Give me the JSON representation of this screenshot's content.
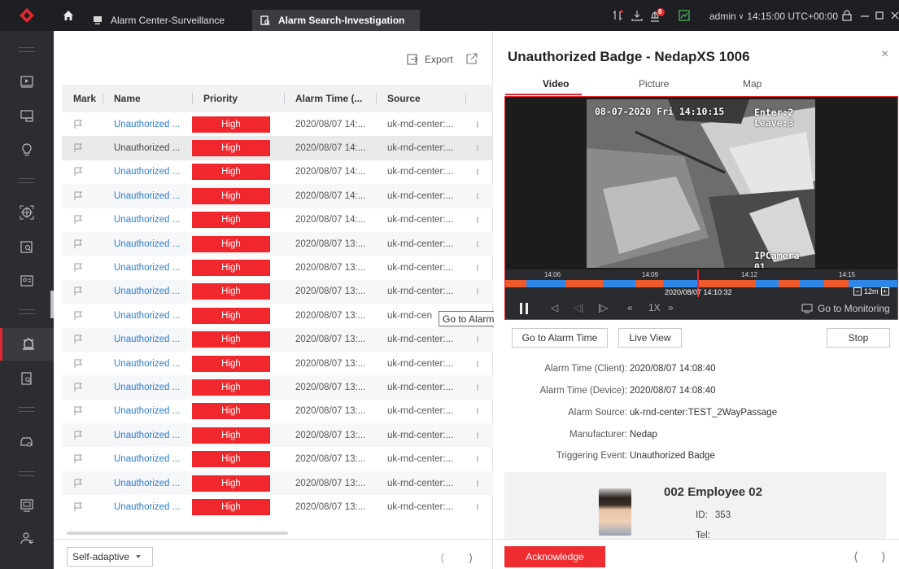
{
  "colors": {
    "accent": "#e1292f",
    "link": "#2a7cd6",
    "priority_high": "#f0282d",
    "topbar": "#1e1f22",
    "sidebar": "#2c2d30"
  },
  "topbar": {
    "tabs": [
      {
        "label": "Alarm Center-Surveillance",
        "icon": "monitor-icon"
      },
      {
        "label": "Alarm Search-Investigation",
        "icon": "search-doc-icon"
      }
    ],
    "notification_count": "8",
    "user": "admin",
    "time": "14:15:00 UTC+00:00"
  },
  "sidebar": {
    "items": [
      "play-screen-icon",
      "camera-screen-icon",
      "bulb-icon",
      "target-icon",
      "calendar-search-icon",
      "id-card-icon",
      "alarm-bell-icon",
      "document-search-icon",
      "vehicle-search-icon",
      "screen-icon",
      "person-icon"
    ],
    "active": "alarm-bell-icon"
  },
  "toolbar": {
    "export_label": "Export"
  },
  "table": {
    "columns": [
      "Mark",
      "Name",
      "Priority",
      "Alarm Time (...",
      "Source"
    ],
    "rows": [
      {
        "name": "Unauthorized ...",
        "priority": "High",
        "time": "2020/08/07 14:...",
        "source": "uk-rnd-center:..."
      },
      {
        "name": "Unauthorized ...",
        "priority": "High",
        "time": "2020/08/07 14:...",
        "source": "uk-rnd-center:..."
      },
      {
        "name": "Unauthorized ...",
        "priority": "High",
        "time": "2020/08/07 14:...",
        "source": "uk-rnd-center:..."
      },
      {
        "name": "Unauthorized ...",
        "priority": "High",
        "time": "2020/08/07 14:...",
        "source": "uk-rnd-center:..."
      },
      {
        "name": "Unauthorized ...",
        "priority": "High",
        "time": "2020/08/07 14:...",
        "source": "uk-rnd-center:..."
      },
      {
        "name": "Unauthorized ...",
        "priority": "High",
        "time": "2020/08/07 13:...",
        "source": "uk-rnd-center:..."
      },
      {
        "name": "Unauthorized ...",
        "priority": "High",
        "time": "2020/08/07 13:...",
        "source": "uk-rnd-center:..."
      },
      {
        "name": "Unauthorized ...",
        "priority": "High",
        "time": "2020/08/07 13:...",
        "source": "uk-rnd-center:..."
      },
      {
        "name": "Unauthorized ...",
        "priority": "High",
        "time": "2020/08/07 13:...",
        "source": "uk-rnd-cen"
      },
      {
        "name": "Unauthorized ...",
        "priority": "High",
        "time": "2020/08/07 13:...",
        "source": "uk-rnd-center:..."
      },
      {
        "name": "Unauthorized ...",
        "priority": "High",
        "time": "2020/08/07 13:...",
        "source": "uk-rnd-center:..."
      },
      {
        "name": "Unauthorized ...",
        "priority": "High",
        "time": "2020/08/07 13:...",
        "source": "uk-rnd-center:..."
      },
      {
        "name": "Unauthorized ...",
        "priority": "High",
        "time": "2020/08/07 13:...",
        "source": "uk-rnd-center:..."
      },
      {
        "name": "Unauthorized ...",
        "priority": "High",
        "time": "2020/08/07 13:...",
        "source": "uk-rnd-center:..."
      },
      {
        "name": "Unauthorized ...",
        "priority": "High",
        "time": "2020/08/07 13:...",
        "source": "uk-rnd-center:..."
      },
      {
        "name": "Unauthorized ...",
        "priority": "High",
        "time": "2020/08/07 13:...",
        "source": "uk-rnd-center:..."
      },
      {
        "name": "Unauthorized ...",
        "priority": "High",
        "time": "2020/08/07 13:...",
        "source": "uk-rnd-center:..."
      }
    ],
    "selected_row": 1
  },
  "footer": {
    "display_mode": "Self-adaptive"
  },
  "tooltip": "Go to Alarm Time",
  "detail": {
    "title": "Unauthorized Badge - NedapXS 1006",
    "tabs": [
      "Video",
      "Picture",
      "Map"
    ],
    "video": {
      "osd_datetime": "08-07-2020 Fri 14:10:15",
      "osd_enter": "Enter:2",
      "osd_leave": "Leave:3",
      "osd_camera": "IPCamera 01",
      "timeline_labels": [
        "14:06",
        "14:09",
        "14:12",
        "14:15"
      ],
      "current_time": "2020/08/07 14:10:32",
      "zoom": "12m",
      "speed": "1X",
      "goto_monitoring": "Go to Monitoring"
    },
    "buttons": {
      "goto_alarm_time": "Go to Alarm Time",
      "live_view": "Live View",
      "stop": "Stop"
    },
    "info": [
      {
        "label": "Alarm Time (Client):",
        "value": "2020/08/07 14:08:40"
      },
      {
        "label": "Alarm Time (Device):",
        "value": "2020/08/07 14:08:40"
      },
      {
        "label": "Alarm Source:",
        "value": "uk-rnd-center:TEST_2WayPassage"
      },
      {
        "label": "Manufacturer:",
        "value": "Nedap"
      },
      {
        "label": "Triggering Event:",
        "value": "Unauthorized Badge"
      }
    ],
    "person": {
      "name": "002 Employee 02",
      "id_label": "ID:",
      "id": "353",
      "tel_label": "Tel:"
    },
    "acknowledge": "Acknowledge"
  }
}
